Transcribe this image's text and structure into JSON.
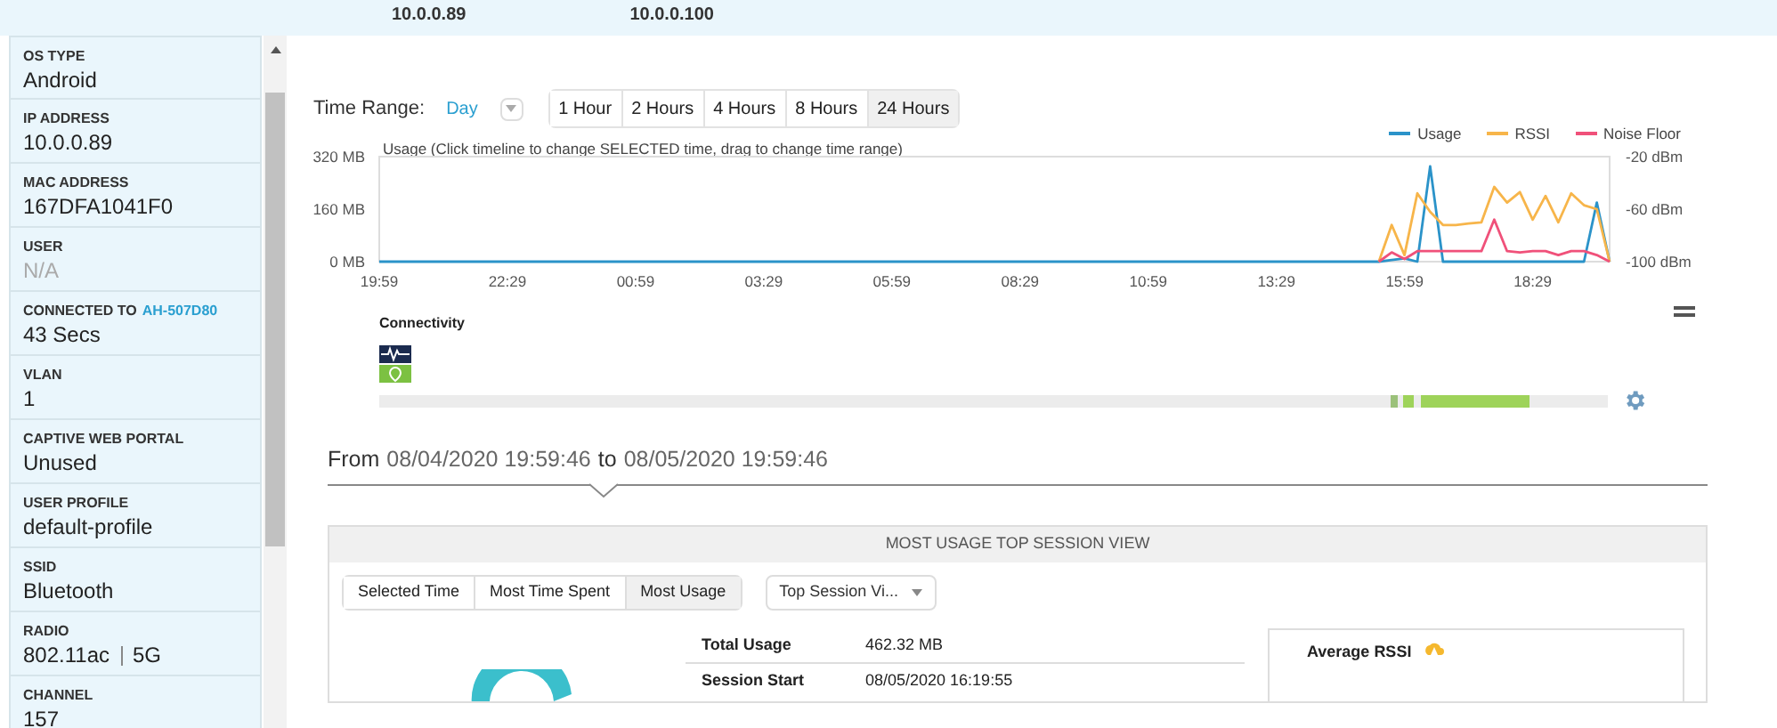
{
  "top_strip": {
    "values": [
      "10.0.0.89",
      "10.0.0.100"
    ]
  },
  "details": [
    {
      "label": "OS TYPE",
      "value": "Android",
      "muted": false
    },
    {
      "label": "IP ADDRESS",
      "value": "10.0.0.89",
      "muted": false
    },
    {
      "label": "MAC ADDRESS",
      "value": "167DFA1041F0",
      "muted": false
    },
    {
      "label": "USER",
      "value": "N/A",
      "muted": true
    },
    {
      "label": "CONNECTED TO",
      "link": "AH-507D80",
      "value": "43 Secs",
      "muted": false
    },
    {
      "label": "VLAN",
      "value": "1",
      "muted": false
    },
    {
      "label": "CAPTIVE WEB PORTAL",
      "value": "Unused",
      "muted": false
    },
    {
      "label": "USER PROFILE",
      "value": "default-profile",
      "muted": false
    },
    {
      "label": "SSID",
      "value": "Bluetooth",
      "muted": false
    },
    {
      "label": "RADIO",
      "values": [
        "802.11ac",
        "5G"
      ],
      "muted": false
    },
    {
      "label": "CHANNEL",
      "value": "157",
      "muted": false
    }
  ],
  "time_range": {
    "label": "Time Range:",
    "value": "Day",
    "options": [
      {
        "label": "1 Hour",
        "selected": false
      },
      {
        "label": "2 Hours",
        "selected": false
      },
      {
        "label": "4 Hours",
        "selected": false
      },
      {
        "label": "8 Hours",
        "selected": false
      },
      {
        "label": "24 Hours",
        "selected": true
      }
    ]
  },
  "chart_data": {
    "type": "line",
    "legend": "top-right",
    "title": "Usage (Click timeline to change SELECTED time, drag to change time range)",
    "categories": [
      "19:59",
      null,
      null,
      null,
      null,
      null,
      null,
      null,
      null,
      null,
      "22:29",
      null,
      null,
      null,
      null,
      null,
      null,
      null,
      null,
      null,
      "00:59",
      null,
      null,
      null,
      null,
      null,
      null,
      null,
      null,
      null,
      "03:29",
      null,
      null,
      null,
      null,
      null,
      null,
      null,
      null,
      null,
      "05:59",
      null,
      null,
      null,
      null,
      null,
      null,
      null,
      null,
      null,
      "08:29",
      null,
      null,
      null,
      null,
      null,
      null,
      null,
      null,
      null,
      "10:59",
      null,
      null,
      null,
      null,
      null,
      null,
      null,
      null,
      null,
      "13:29",
      null,
      null,
      null,
      null,
      null,
      null,
      null,
      null,
      null,
      "15:59",
      null,
      null,
      null,
      null,
      null,
      null,
      null,
      null,
      null,
      "18:29",
      null,
      null,
      null,
      null,
      null,
      null
    ],
    "ylim": [
      0,
      320
    ],
    "yticks": [
      {
        "value": 0,
        "label": "0 MB"
      },
      {
        "value": 160,
        "label": "160 MB"
      },
      {
        "value": 320,
        "label": "320 MB"
      }
    ],
    "y2lim": [
      -100,
      -20
    ],
    "y2ticks": [
      {
        "value": -100,
        "label": "-100 dBm"
      },
      {
        "value": -60,
        "label": "-60 dBm"
      },
      {
        "value": -20,
        "label": "-20 dBm"
      }
    ],
    "series": [
      {
        "name": "Usage",
        "color": "#2b93c9",
        "values": [
          0,
          0,
          0,
          0,
          0,
          0,
          0,
          0,
          0,
          0,
          0,
          0,
          0,
          0,
          0,
          0,
          0,
          0,
          0,
          0,
          0,
          0,
          0,
          0,
          0,
          0,
          0,
          0,
          0,
          0,
          0,
          0,
          0,
          0,
          0,
          0,
          0,
          0,
          0,
          0,
          0,
          0,
          0,
          0,
          0,
          0,
          0,
          0,
          0,
          0,
          0,
          0,
          0,
          0,
          0,
          0,
          0,
          0,
          0,
          0,
          0,
          0,
          0,
          0,
          0,
          0,
          0,
          0,
          0,
          0,
          0,
          0,
          0,
          0,
          0,
          0,
          0,
          0,
          0,
          5,
          10,
          0,
          290,
          0,
          0,
          0,
          0,
          0,
          0,
          0,
          0,
          0,
          0,
          0,
          0,
          180,
          0
        ]
      },
      {
        "name": "RSSI",
        "color": "#f7b54a",
        "axis": "y2",
        "values": [
          null,
          null,
          null,
          null,
          null,
          null,
          null,
          null,
          null,
          null,
          null,
          null,
          null,
          null,
          null,
          null,
          null,
          null,
          null,
          null,
          null,
          null,
          null,
          null,
          null,
          null,
          null,
          null,
          null,
          null,
          null,
          null,
          null,
          null,
          null,
          null,
          null,
          null,
          null,
          null,
          null,
          null,
          null,
          null,
          null,
          null,
          null,
          null,
          null,
          null,
          null,
          null,
          null,
          null,
          null,
          null,
          null,
          null,
          null,
          null,
          null,
          null,
          null,
          null,
          null,
          null,
          null,
          null,
          null,
          null,
          null,
          null,
          null,
          null,
          null,
          null,
          null,
          null,
          -100,
          -72,
          -95,
          -48,
          -62,
          -72,
          -72,
          -71,
          -70,
          -43,
          -55,
          -47,
          -68,
          -50,
          -70,
          -48,
          -57,
          -60,
          -100
        ]
      },
      {
        "name": "Noise Floor",
        "color": "#f0517a",
        "axis": "y2",
        "values": [
          null,
          null,
          null,
          null,
          null,
          null,
          null,
          null,
          null,
          null,
          null,
          null,
          null,
          null,
          null,
          null,
          null,
          null,
          null,
          null,
          null,
          null,
          null,
          null,
          null,
          null,
          null,
          null,
          null,
          null,
          null,
          null,
          null,
          null,
          null,
          null,
          null,
          null,
          null,
          null,
          null,
          null,
          null,
          null,
          null,
          null,
          null,
          null,
          null,
          null,
          null,
          null,
          null,
          null,
          null,
          null,
          null,
          null,
          null,
          null,
          null,
          null,
          null,
          null,
          null,
          null,
          null,
          null,
          null,
          null,
          null,
          null,
          null,
          null,
          null,
          null,
          null,
          null,
          -100,
          -93,
          -98,
          -92,
          -92,
          -92,
          -92,
          -92,
          -92,
          -68,
          -92,
          -93,
          -92,
          -92,
          -95,
          -92,
          -92,
          -95,
          -100
        ]
      }
    ]
  },
  "connectivity": {
    "title": "Connectivity"
  },
  "range": {
    "from_label": "From",
    "from": "08/04/2020 19:59:46",
    "to_label": "to",
    "to": "08/05/2020 19:59:46"
  },
  "session_view": {
    "title": "MOST USAGE TOP SESSION VIEW",
    "tabs": [
      {
        "label": "Selected Time",
        "selected": false
      },
      {
        "label": "Most Time Spent",
        "selected": false
      },
      {
        "label": "Most Usage",
        "selected": true
      }
    ],
    "dropdown": "Top Session Vi...",
    "rows": [
      {
        "label": "Total Usage",
        "value": "462.32 MB"
      },
      {
        "label": "Session Start",
        "value": "08/05/2020 16:19:55"
      }
    ],
    "rssi_card": {
      "title": "Average RSSI"
    }
  }
}
